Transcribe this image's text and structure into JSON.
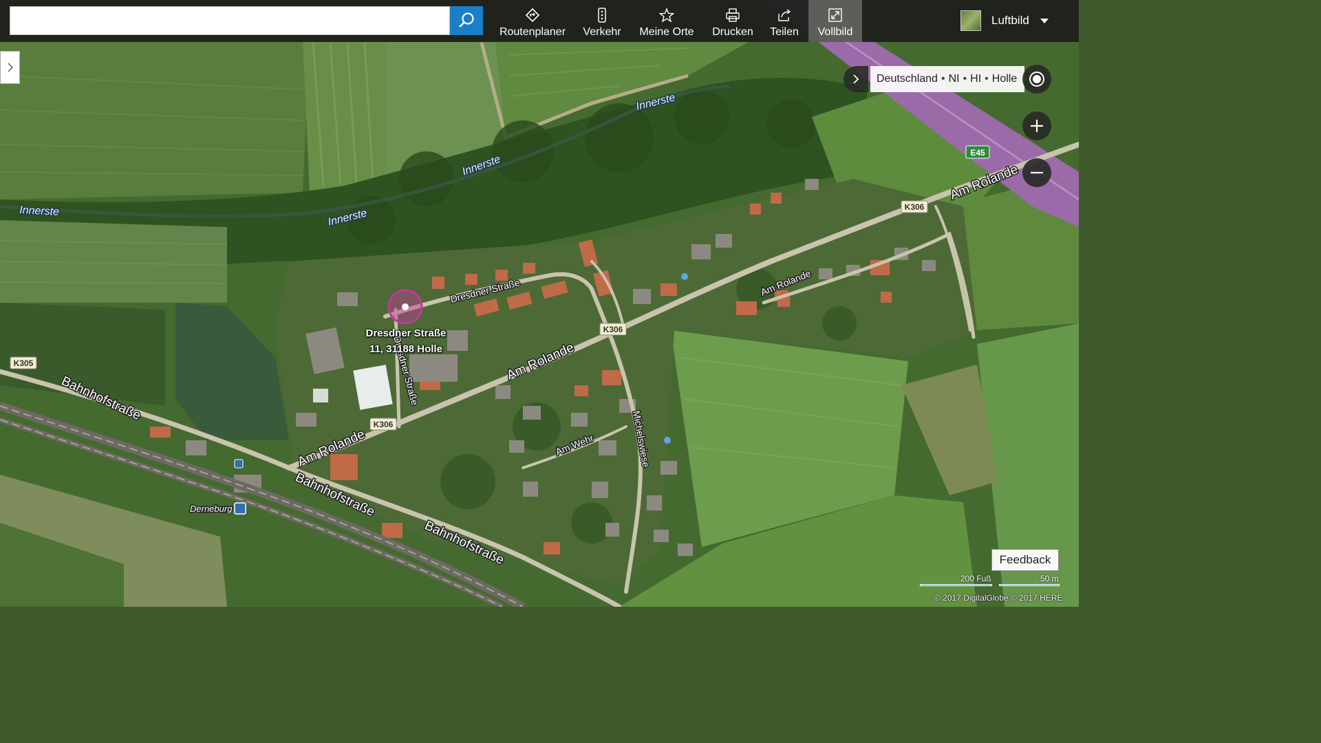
{
  "toolbar": {
    "search_value": "",
    "items": [
      {
        "label": "Routenplaner",
        "icon": "route-icon"
      },
      {
        "label": "Verkehr",
        "icon": "traffic-icon"
      },
      {
        "label": "Meine Orte",
        "icon": "star-icon"
      },
      {
        "label": "Drucken",
        "icon": "print-icon"
      },
      {
        "label": "Teilen",
        "icon": "share-icon"
      },
      {
        "label": "Vollbild",
        "icon": "fullscreen-icon"
      }
    ],
    "active_item": "Vollbild",
    "layer_label": "Luftbild"
  },
  "breadcrumb": [
    "Deutschland",
    "NI",
    "HI",
    "Holle"
  ],
  "breadcrumb_separator": "•",
  "pin": {
    "line1": "Dresdner Straße",
    "line2": "11, 31188 Holle",
    "color": "#c0399c"
  },
  "map_labels": {
    "innerste_1": "Innerste",
    "innerste_2": "Innerste",
    "innerste_3": "Innerste",
    "innerste_4": "Innerste",
    "dresdner_1": "Dresdner Straße",
    "dresdner_2": "Dresdner Straße",
    "am_rolande_1": "Am Rolande",
    "am_rolande_2": "Am Rolande",
    "am_rolande_3": "Am Rolande",
    "am_rolande_4": "Am Rolande",
    "bahnhof_1": "Bahnhofstraße",
    "bahnhof_2": "Bahnhofstraße",
    "bahnhof_3": "Bahnhofstraße",
    "am_wehr": "Am Wehr",
    "michelswiese": "Michelswiese",
    "derneburg": "Derneburg",
    "k305": "K305",
    "k306_1": "K306",
    "k306_2": "K306",
    "k306_3": "K306",
    "e45": "E45"
  },
  "feedback_label": "Feedback",
  "scale": {
    "imperial": "200 Fuß",
    "metric": "50 m"
  },
  "copyright": "© 2017 DigitalGlobe © 2017 HERE",
  "colors": {
    "accent": "#1b7fc8",
    "pin": "#c0399c",
    "road_shield": "#f2efcf",
    "motorway": "#9b6aa8"
  }
}
